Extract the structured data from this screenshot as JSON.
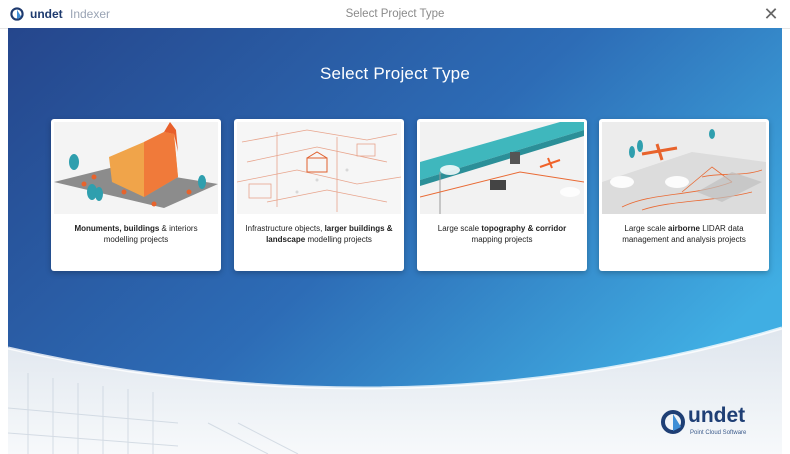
{
  "titlebar": {
    "brand": "undet",
    "product": "Indexer",
    "title": "Select Project Type",
    "close_glyph": "✕"
  },
  "main": {
    "heading": "Select Project Type",
    "cards": [
      {
        "pre": "",
        "bold1": "Monuments, buildings",
        "mid": " & interiors modelling projects",
        "bold2": "",
        "post": ""
      },
      {
        "pre": "Infrastructure objects, ",
        "bold1": "larger buildings & landscape",
        "mid": " modelling projects",
        "bold2": "",
        "post": ""
      },
      {
        "pre": "Large scale ",
        "bold1": "topography & corridor",
        "mid": " mapping projects",
        "bold2": "",
        "post": ""
      },
      {
        "pre": "Large scale ",
        "bold1": "airborne",
        "mid": " LIDAR data management and analysis projects",
        "bold2": "",
        "post": ""
      }
    ]
  },
  "footer": {
    "logo_word": "undet",
    "logo_sub": "Point Cloud Software"
  },
  "colors": {
    "bg_top": "#234a92",
    "bg_bottom_right": "#3ea9e0",
    "accent_orange": "#f0632a",
    "brand_dark": "#1f3f75"
  },
  "icons": {
    "brand": "undet-logo-icon",
    "close": "close-icon"
  }
}
